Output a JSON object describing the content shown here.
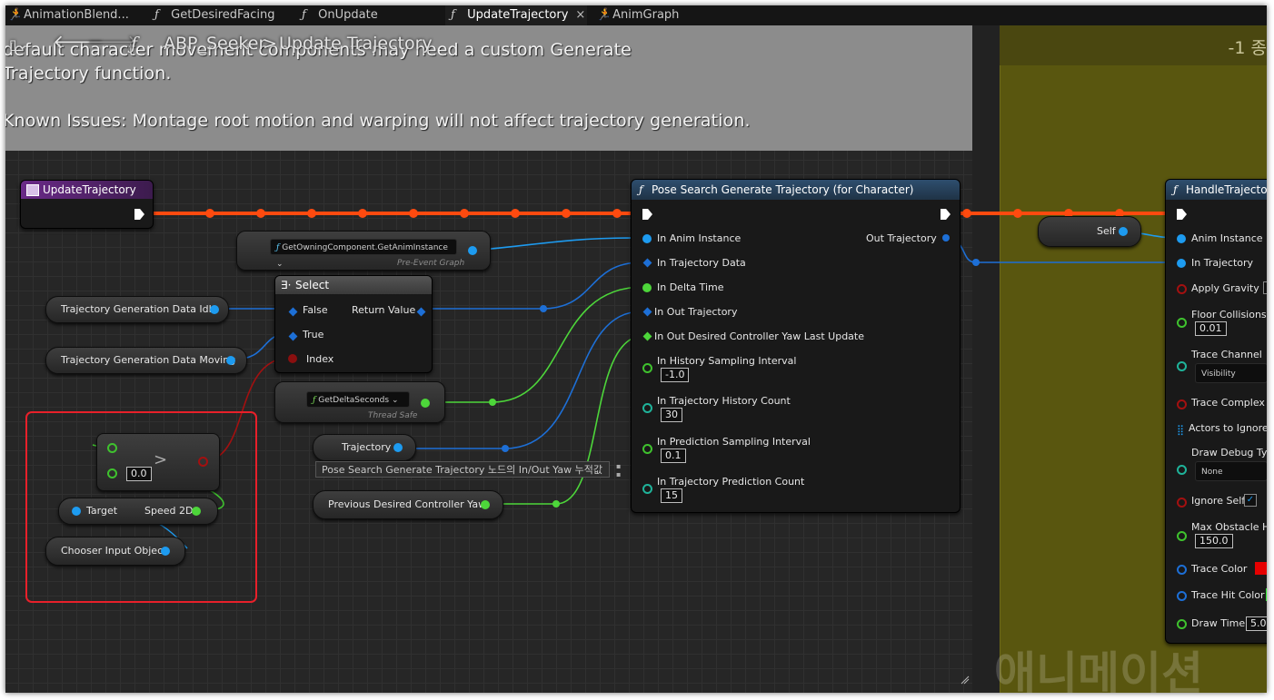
{
  "tabs": [
    {
      "label": "AnimationBlend...",
      "icon": "running-man-icon"
    },
    {
      "label": "GetDesiredFacing",
      "icon": "function-icon"
    },
    {
      "label": "OnUpdate",
      "icon": "function-icon"
    },
    {
      "label": "UpdateTrajectory",
      "icon": "function-icon",
      "active": true,
      "close": "×"
    },
    {
      "label": "AnimGraph",
      "icon": "running-man-icon"
    }
  ],
  "breadcrumb": {
    "root": "ABP_Seeker",
    "separator": ">",
    "current": "Update Trajectory"
  },
  "comment": {
    "line1": "default character movement components may need a custom Generate",
    "line2": "Trajectory function.",
    "line3": "Known Issues: Montage root motion and warping will not affect trajectory generation.",
    "right_text": "-1 종"
  },
  "nodes": {
    "event": {
      "title": "UpdateTrajectory"
    },
    "get_owning": {
      "label": "GetOwningComponent.GetAnimInstance",
      "note": "Pre-Event Graph"
    },
    "select": {
      "title": "Select",
      "false": "False",
      "true": "True",
      "index": "Index",
      "return": "Return Value"
    },
    "traj_idle": {
      "label": "Trajectory Generation Data Idle"
    },
    "traj_moving": {
      "label": "Trajectory Generation Data Moving"
    },
    "delta": {
      "label": "GetDeltaSeconds",
      "note": "Thread Safe"
    },
    "traj_var": {
      "label": "Trajectory",
      "tooltip": "Pose Search Generate Trajectory 노드의 In/Out Yaw 누적값"
    },
    "prev_yaw": {
      "label": "Previous Desired Controller Yaw"
    },
    "greater": {
      "symbol": ">",
      "value": "0.0"
    },
    "target_speed": {
      "target": "Target",
      "speed": "Speed 2D"
    },
    "chooser": {
      "label": "Chooser Input Object"
    },
    "pose_search": {
      "title": "Pose Search Generate Trajectory (for Character)",
      "pins": [
        "In Anim Instance",
        "In Trajectory Data",
        "In Delta Time",
        "In Out Trajectory",
        "In Out Desired Controller Yaw Last Update"
      ],
      "out": "Out Trajectory",
      "params": [
        {
          "label": "In History Sampling Interval",
          "value": "-1.0"
        },
        {
          "label": "In Trajectory History Count",
          "value": "30"
        },
        {
          "label": "In Prediction Sampling Interval",
          "value": "0.1"
        },
        {
          "label": "In Trajectory Prediction Count",
          "value": "15"
        }
      ]
    },
    "self": {
      "label": "Self"
    },
    "handle": {
      "title": "HandleTrajector",
      "rows": [
        {
          "label": "Anim Instance"
        },
        {
          "label": "In Trajectory"
        },
        {
          "label": "Apply Gravity"
        },
        {
          "label": "Floor Collisions C",
          "value": "0.01"
        },
        {
          "label": "Trace Channel",
          "value": "Visibility"
        },
        {
          "label": "Trace Complex"
        },
        {
          "label": "Actors to Ignore"
        },
        {
          "label": "Draw Debug Type",
          "value": "None"
        },
        {
          "label": "Ignore Self"
        },
        {
          "label": "Max Obstacle He",
          "value": "150.0"
        },
        {
          "label": "Trace Color"
        },
        {
          "label": "Trace Hit Color"
        },
        {
          "label": "Draw Time",
          "value": "5.0"
        }
      ]
    }
  },
  "watermark": "애니메이션",
  "colors": {
    "exec_wire": "#ff4a0f",
    "highlight": "#e8202a",
    "comment_yellow": "#59560f",
    "comment_gray": "#8c8c8c"
  }
}
